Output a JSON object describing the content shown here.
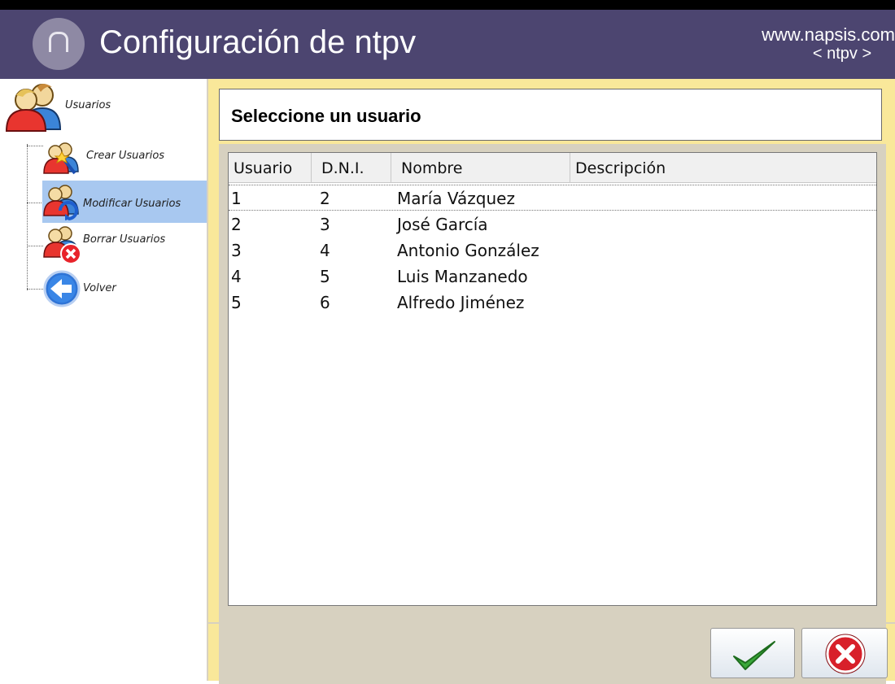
{
  "header": {
    "title": "Configuración de ntpv",
    "url": "www.napsis.com",
    "subtitle": "< ntpv >"
  },
  "sidebar": {
    "root_label": "Usuarios",
    "items": [
      {
        "label": "Crear Usuarios",
        "icon": "users-wand-icon"
      },
      {
        "label": "Modificar Usuarios",
        "icon": "users-refresh-icon",
        "selected": true
      },
      {
        "label": "Borrar Usuarios",
        "icon": "users-delete-icon"
      },
      {
        "label": "Volver",
        "icon": "back-arrow-icon"
      }
    ]
  },
  "panel": {
    "title": "Seleccione un usuario"
  },
  "table": {
    "columns": [
      "Usuario",
      "D.N.I.",
      "Nombre",
      "Descripción"
    ],
    "rows": [
      {
        "usuario": "1",
        "dni": "2",
        "nombre": "María Vázquez",
        "descripcion": ""
      },
      {
        "usuario": "2",
        "dni": "3",
        "nombre": "José García",
        "descripcion": ""
      },
      {
        "usuario": "3",
        "dni": "4",
        "nombre": "Antonio González",
        "descripcion": ""
      },
      {
        "usuario": "4",
        "dni": "5",
        "nombre": "Luis Manzanedo",
        "descripcion": ""
      },
      {
        "usuario": "5",
        "dni": "6",
        "nombre": "Alfredo Jiménez",
        "descripcion": ""
      }
    ]
  },
  "buttons": {
    "accept_icon": "checkmark-icon",
    "cancel_icon": "cancel-icon"
  },
  "colors": {
    "header_bg": "#4c4570",
    "panel_bg": "#f9e89a",
    "selected_bg": "#a8c8f0",
    "accept_green": "#3aa83a",
    "cancel_red": "#d8202a"
  }
}
